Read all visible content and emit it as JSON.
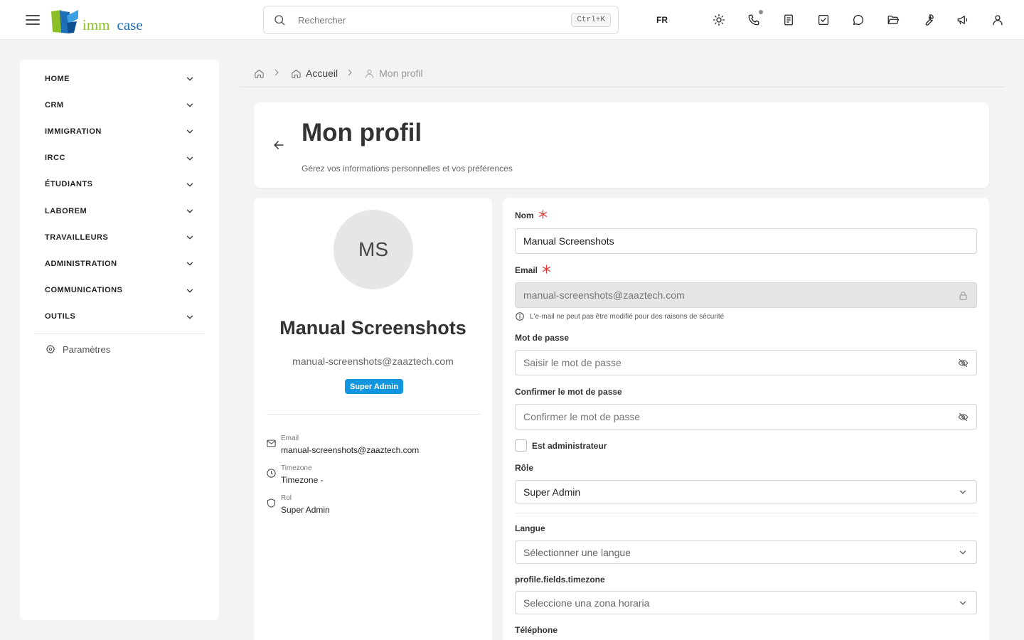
{
  "header": {
    "logo": {
      "part1": "imm",
      "part2": "case",
      "colors": {
        "green": "#8cbf26",
        "blue": "#1e6fb5"
      }
    },
    "search": {
      "placeholder": "Rechercher",
      "shortcut": "Ctrl+K"
    },
    "language": "FR",
    "icons": [
      "sun-icon",
      "phone-icon",
      "document-icon",
      "task-check-icon",
      "chat-icon",
      "folder-open-icon",
      "wrench-icon",
      "megaphone-icon",
      "user-icon"
    ]
  },
  "sidebar": {
    "items": [
      {
        "label": "HOME"
      },
      {
        "label": "CRM"
      },
      {
        "label": "IMMIGRATION"
      },
      {
        "label": "IRCC"
      },
      {
        "label": "ÉTUDIANTS"
      },
      {
        "label": "LABOREM"
      },
      {
        "label": "TRAVAILLEURS"
      },
      {
        "label": "ADMINISTRATION"
      },
      {
        "label": "COMMUNICATIONS"
      },
      {
        "label": "OUTILS"
      }
    ],
    "settings_label": "Paramètres"
  },
  "breadcrumb": {
    "home": "Accueil",
    "current": "Mon profil"
  },
  "page": {
    "title": "Mon profil",
    "subtitle": "Gérez vos informations personnelles et vos préférences"
  },
  "profile": {
    "initials": "MS",
    "name": "Manual Screenshots",
    "email": "manual-screenshots@zaaztech.com",
    "badge": "Super Admin",
    "badge_color": "#1296e0",
    "info": [
      {
        "label": "Email",
        "value": "manual-screenshots@zaaztech.com"
      },
      {
        "label": "Timezone",
        "value": "Timezone -"
      },
      {
        "label": "Rol",
        "value": "Super Admin"
      }
    ]
  },
  "form": {
    "name": {
      "label": "Nom",
      "value": "Manual Screenshots"
    },
    "email": {
      "label": "Email",
      "value": "manual-screenshots@zaaztech.com",
      "hint": "L'e-mail ne peut pas être modifié pour des raisons de sécurité"
    },
    "password": {
      "label": "Mot de passe",
      "placeholder": "Saisir le mot de passe"
    },
    "confirm_password": {
      "label": "Confirmer le mot de passe",
      "placeholder": "Confirmer le mot de passe"
    },
    "is_admin_label": "Est administrateur",
    "role": {
      "label": "Rôle",
      "value": "Super Admin"
    },
    "language": {
      "label": "Langue",
      "placeholder": "Sélectionner une langue"
    },
    "timezone": {
      "label": "profile.fields.timezone",
      "placeholder": "Seleccione una zona horaria"
    },
    "phone_label": "Téléphone",
    "required_color": "#e53935"
  }
}
